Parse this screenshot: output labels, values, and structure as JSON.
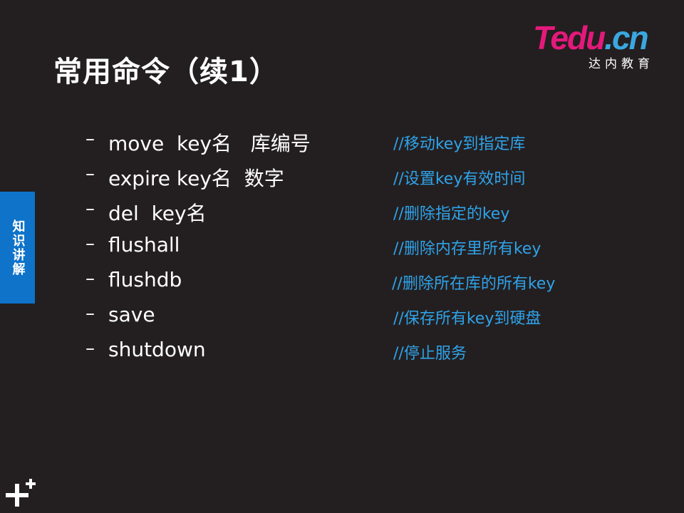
{
  "title": "常用命令（续1）",
  "logo": {
    "word_t": "T",
    "word_edu": "edu",
    "word_cn": ".cn",
    "subtitle": "达内教育"
  },
  "side_tab": {
    "label": "知识讲解"
  },
  "commands": [
    {
      "dash": "–",
      "command": "move  key名   库编号",
      "comment": "//移动key到指定库"
    },
    {
      "dash": "–",
      "command": "expire key名  数字",
      "comment": "//设置key有效时间"
    },
    {
      "dash": "–",
      "command": "del  key名",
      "comment": "//删除指定的key"
    },
    {
      "dash": "–",
      "command": "flushall",
      "comment": "//删除内存里所有key"
    },
    {
      "dash": "–",
      "command": "flushdb",
      "comment": "//删除所在库的所有key"
    },
    {
      "dash": "–",
      "command": "save",
      "comment": "//保存所有key到硬盘"
    },
    {
      "dash": "–",
      "command": "shutdown",
      "comment": "//停止服务"
    }
  ],
  "colors": {
    "background": "#231f20",
    "comment": "#2fa3ea",
    "tab": "#0e73c9",
    "logo_pink": "#e4197b",
    "logo_blue": "#3aa7e0"
  },
  "icons": {
    "corner": "plus-icon"
  }
}
